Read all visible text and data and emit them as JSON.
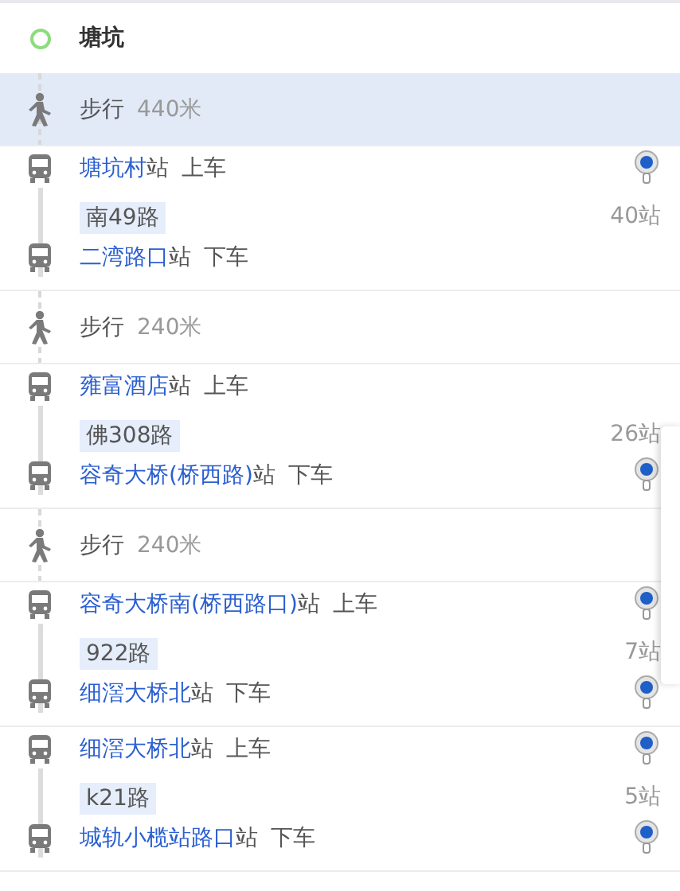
{
  "steps": [
    {
      "kind": "start",
      "name": "塘坑"
    },
    {
      "kind": "walk",
      "label": "步行",
      "distance": "440米",
      "highlighted": true
    },
    {
      "kind": "bus",
      "board": {
        "name": "塘坑村",
        "suffix": "站",
        "action": "上车",
        "pin": true
      },
      "line": "南49路",
      "stops": "40站",
      "alight": {
        "name": "二湾路口",
        "suffix": "站",
        "action": "下车",
        "pin": false
      }
    },
    {
      "kind": "walk",
      "label": "步行",
      "distance": "240米",
      "highlighted": false
    },
    {
      "kind": "bus",
      "board": {
        "name": "雍富酒店",
        "suffix": "站",
        "action": "上车",
        "pin": false
      },
      "line": "佛308路",
      "stops": "26站",
      "alight": {
        "name": "容奇大桥(桥西路)",
        "suffix": "站",
        "action": "下车",
        "pin": true
      }
    },
    {
      "kind": "walk",
      "label": "步行",
      "distance": "240米",
      "highlighted": false
    },
    {
      "kind": "bus",
      "board": {
        "name": "容奇大桥南(桥西路口)",
        "suffix": "站",
        "action": "上车",
        "pin": true
      },
      "line": "922路",
      "stops": "7站",
      "alight": {
        "name": "细滘大桥北",
        "suffix": "站",
        "action": "下车",
        "pin": true
      }
    },
    {
      "kind": "bus",
      "board": {
        "name": "细滘大桥北",
        "suffix": "站",
        "action": "上车",
        "pin": true
      },
      "line": "k21路",
      "stops": "5站",
      "alight": {
        "name": "城轨小榄站路口",
        "suffix": "站",
        "action": "下车",
        "pin": true
      }
    }
  ]
}
